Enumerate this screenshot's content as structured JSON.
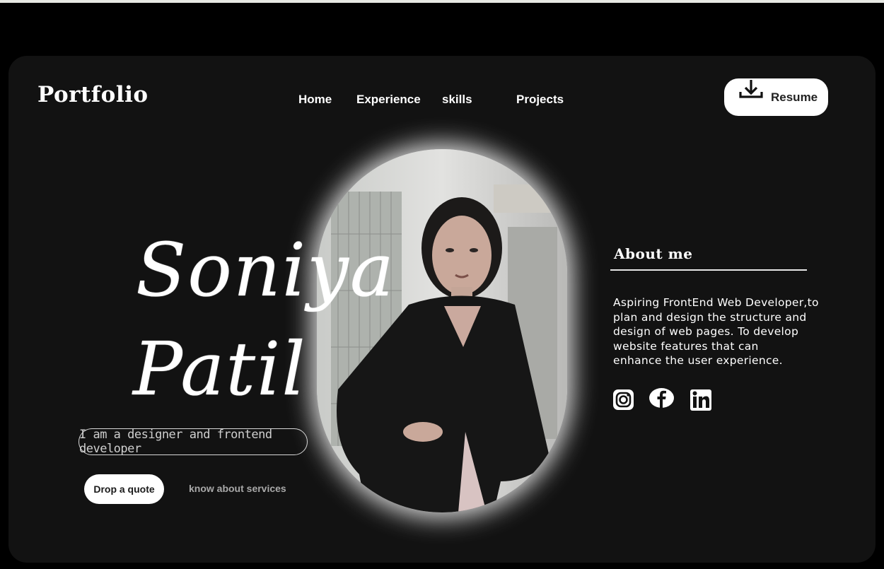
{
  "header": {
    "logo": "Portfolio",
    "nav": [
      "Home",
      "Experience",
      "skills",
      "Projects"
    ],
    "resume_label": "Resume"
  },
  "hero": {
    "first_name": "Soniya",
    "last_name": "Patil",
    "tagline": "I am a designer and frontend developer",
    "primary_button": "Drop a quote",
    "secondary_link": "know about services"
  },
  "about": {
    "title": "About me",
    "text": "Aspiring FrontEnd Web Developer,to\nplan and design the structure and\ndesign of web pages. To develop\nwebsite features that can\nenhance the user experience."
  },
  "social": [
    "instagram-icon",
    "facebook-icon",
    "linkedin-icon"
  ],
  "colors": {
    "background": "#000000",
    "card": "#121212",
    "text": "#ffffff",
    "muted": "#a9a9a9"
  }
}
